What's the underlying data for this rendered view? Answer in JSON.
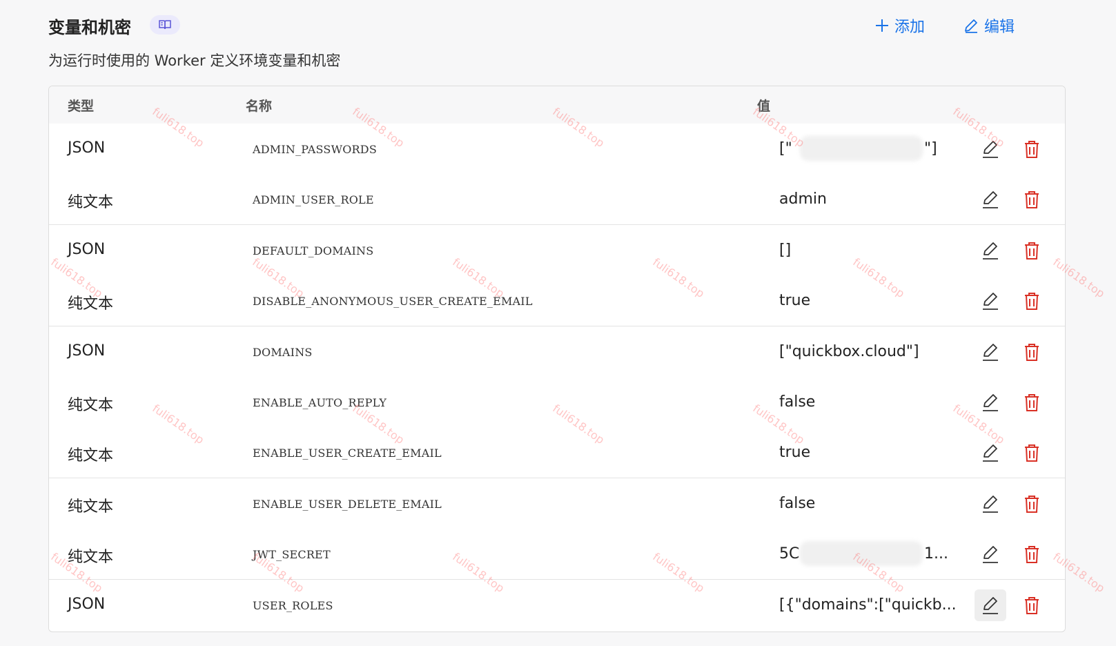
{
  "header": {
    "title": "变量和机密",
    "subtitle": "为运行时使用的 Worker 定义环境变量和机密",
    "add_label": "添加",
    "edit_label": "编辑"
  },
  "table": {
    "columns": [
      "类型",
      "名称",
      "值"
    ],
    "rows": [
      {
        "type": "JSON",
        "name": "ADMIN_PASSWORDS",
        "value": "[\"",
        "value_end": "\"]",
        "redacted": true
      },
      {
        "type": "纯文本",
        "name": "ADMIN_USER_ROLE",
        "value": "admin"
      },
      {
        "type": "JSON",
        "name": "DEFAULT_DOMAINS",
        "value": "[]"
      },
      {
        "type": "纯文本",
        "name": "DISABLE_ANONYMOUS_USER_CREATE_EMAIL",
        "value": "true"
      },
      {
        "type": "JSON",
        "name": "DOMAINS",
        "value": "[\"quickbox.cloud\"]"
      },
      {
        "type": "纯文本",
        "name": "ENABLE_AUTO_REPLY",
        "value": "false"
      },
      {
        "type": "纯文本",
        "name": "ENABLE_USER_CREATE_EMAIL",
        "value": "true"
      },
      {
        "type": "纯文本",
        "name": "ENABLE_USER_DELETE_EMAIL",
        "value": "false"
      },
      {
        "type": "纯文本",
        "name": "JWT_SECRET",
        "value": "5C",
        "value_end": "1...",
        "redacted": true
      },
      {
        "type": "JSON",
        "name": "USER_ROLES",
        "value": "[{\"domains\":[\"quickb..."
      }
    ]
  },
  "watermark": "fuli618.top",
  "colors": {
    "accent": "#1a73e8",
    "danger": "#d93025",
    "badge_bg": "#ebeafc",
    "badge_fg": "#5b54d6"
  },
  "icons": {
    "badge": "book-open-icon",
    "add": "plus-icon",
    "edit": "pencil-icon",
    "delete": "trash-icon"
  }
}
